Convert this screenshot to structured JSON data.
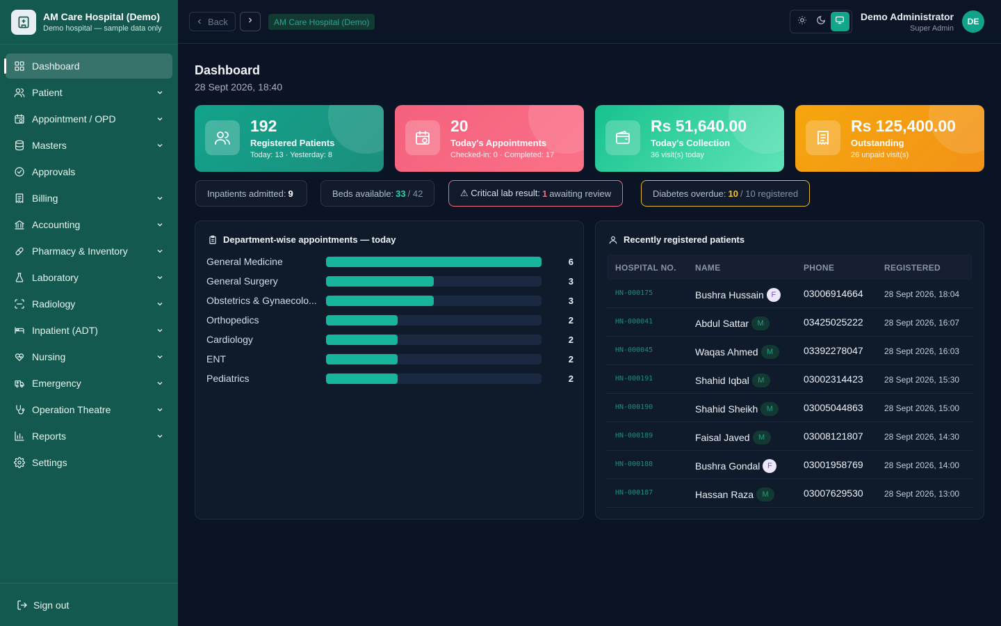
{
  "brand": {
    "title": "AM Care Hospital (Demo)",
    "subtitle": "Demo hospital — sample data only"
  },
  "sidebar": {
    "items": [
      {
        "label": "Dashboard",
        "icon": "dashboard-grid-icon",
        "active": true,
        "expandable": false
      },
      {
        "label": "Patient",
        "icon": "users-icon",
        "expandable": true
      },
      {
        "label": "Appointment / OPD",
        "icon": "calendar-clock-icon",
        "expandable": true
      },
      {
        "label": "Masters",
        "icon": "database-icon",
        "expandable": true
      },
      {
        "label": "Approvals",
        "icon": "check-circle-icon",
        "expandable": false
      },
      {
        "label": "Billing",
        "icon": "receipt-icon",
        "expandable": true
      },
      {
        "label": "Accounting",
        "icon": "bank-icon",
        "expandable": true
      },
      {
        "label": "Pharmacy & Inventory",
        "icon": "pill-icon",
        "expandable": true
      },
      {
        "label": "Laboratory",
        "icon": "flask-icon",
        "expandable": true
      },
      {
        "label": "Radiology",
        "icon": "scan-icon",
        "expandable": true
      },
      {
        "label": "Inpatient (ADT)",
        "icon": "bed-icon",
        "expandable": true
      },
      {
        "label": "Nursing",
        "icon": "heart-hand-icon",
        "expandable": true
      },
      {
        "label": "Emergency",
        "icon": "ambulance-icon",
        "expandable": true
      },
      {
        "label": "Operation Theatre",
        "icon": "stethoscope-icon",
        "expandable": true
      },
      {
        "label": "Reports",
        "icon": "bar-chart-icon",
        "expandable": true
      },
      {
        "label": "Settings",
        "icon": "gear-icon",
        "expandable": false
      }
    ],
    "signout_label": "Sign out"
  },
  "topbar": {
    "back_label": "Back",
    "breadcrumb": "AM Care Hospital (Demo)",
    "user_name": "Demo Administrator",
    "user_role": "Super Admin",
    "avatar_initials": "DE",
    "theme_active": "system"
  },
  "page": {
    "title": "Dashboard",
    "date": "28 Sept 2026, 18:40"
  },
  "stats": [
    {
      "value": "192",
      "label": "Registered Patients",
      "sub": "Today: 13 · Yesterday: 8",
      "color": "#14a58d",
      "icon": "users-icon"
    },
    {
      "value": "20",
      "label": "Today's Appointments",
      "sub": "Checked-in: 0 · Completed: 17",
      "color": "#f4617c",
      "icon": "calendar-clock-icon"
    },
    {
      "value": "Rs 51,640.00",
      "label": "Today's Collection",
      "sub": "36 visit(s) today",
      "color": "#22c796",
      "icon": "wallet-icon"
    },
    {
      "value": "Rs 125,400.00",
      "label": "Outstanding",
      "sub": "26 unpaid visit(s)",
      "color": "#f59e0b",
      "icon": "receipt-icon"
    }
  ],
  "alerts": {
    "inpatients": {
      "label": "Inpatients admitted:",
      "value": "9"
    },
    "beds": {
      "label": "Beds available:",
      "value": "33",
      "total": "/ 42"
    },
    "critical": {
      "label": "⚠ Critical lab result:",
      "value": "1",
      "suffix": "awaiting review"
    },
    "diabetes": {
      "label": "Diabetes overdue:",
      "value": "10",
      "suffix": "/ 10 registered"
    }
  },
  "departments": {
    "title": "Department-wise appointments — today",
    "max": 6,
    "rows": [
      {
        "name": "General Medicine",
        "count": 6
      },
      {
        "name": "General Surgery",
        "count": 3
      },
      {
        "name": "Obstetrics & Gynaecolo...",
        "count": 3
      },
      {
        "name": "Orthopedics",
        "count": 2
      },
      {
        "name": "Cardiology",
        "count": 2
      },
      {
        "name": "ENT",
        "count": 2
      },
      {
        "name": "Pediatrics",
        "count": 2
      }
    ]
  },
  "patients": {
    "title": "Recently registered patients",
    "columns": [
      "HOSPITAL NO.",
      "NAME",
      "PHONE",
      "REGISTERED"
    ],
    "rows": [
      {
        "hn": "HN-000175",
        "name": "Bushra Hussain",
        "gender": "F",
        "phone": "03006914664",
        "registered": "28 Sept 2026, 18:04"
      },
      {
        "hn": "HN-000041",
        "name": "Abdul Sattar",
        "gender": "M",
        "phone": "03425025222",
        "registered": "28 Sept 2026, 16:07"
      },
      {
        "hn": "HN-000045",
        "name": "Waqas Ahmed",
        "gender": "M",
        "phone": "03392278047",
        "registered": "28 Sept 2026, 16:03"
      },
      {
        "hn": "HN-000191",
        "name": "Shahid Iqbal",
        "gender": "M",
        "phone": "03002314423",
        "registered": "28 Sept 2026, 15:30"
      },
      {
        "hn": "HN-000190",
        "name": "Shahid Sheikh",
        "gender": "M",
        "phone": "03005044863",
        "registered": "28 Sept 2026, 15:00"
      },
      {
        "hn": "HN-000189",
        "name": "Faisal Javed",
        "gender": "M",
        "phone": "03008121807",
        "registered": "28 Sept 2026, 14:30"
      },
      {
        "hn": "HN-000188",
        "name": "Bushra Gondal",
        "gender": "F",
        "phone": "03001958769",
        "registered": "28 Sept 2026, 14:00"
      },
      {
        "hn": "HN-000187",
        "name": "Hassan Raza",
        "gender": "M",
        "phone": "03007629530",
        "registered": "28 Sept 2026, 13:00"
      }
    ]
  }
}
